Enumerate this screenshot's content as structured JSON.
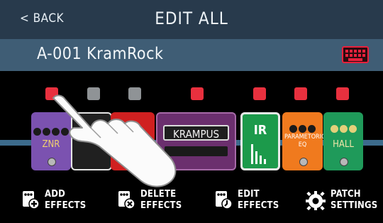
{
  "header": {
    "back_label": "< BACK",
    "title": "EDIT ALL"
  },
  "patch": {
    "name": "A-001 KramRock",
    "keyboard_icon": "keyboard-icon"
  },
  "colors": {
    "header_bg": "#283a4c",
    "patch_bar_bg": "#3f5d75",
    "led_on": "#e8303e",
    "led_off": "#8f9396",
    "accent": "#e8213c"
  },
  "effects": [
    {
      "name": "ZNR",
      "color": "#7b52b0"
    },
    {
      "name": "",
      "color": "#202020"
    },
    {
      "name": "",
      "color": "#d02020"
    },
    {
      "name": "KRAMPUS",
      "color": "#6b2f6e"
    },
    {
      "name": "IR",
      "color": "#1c9a4b"
    },
    {
      "name": "PARAMETORIC EQ",
      "color": "#f07a1e"
    },
    {
      "name": "HALL",
      "color": "#1f9a5a"
    }
  ],
  "toolbar": {
    "add": {
      "line1": "ADD",
      "line2": "EFFECTS"
    },
    "delete": {
      "line1": "DELETE",
      "line2": "EFFECTS"
    },
    "edit": {
      "line1": "EDIT",
      "line2": "EFFECTS"
    },
    "patch_settings": {
      "line1": "PATCH",
      "line2": "SETTINGS"
    }
  }
}
